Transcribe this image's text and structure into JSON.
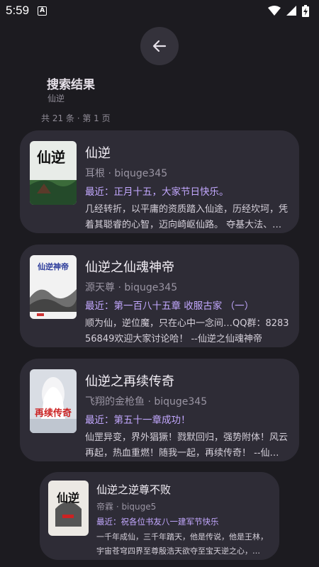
{
  "status": {
    "time": "5:59",
    "notification_letter": "A"
  },
  "header": {
    "title": "搜索结果",
    "query": "仙逆",
    "count_text": "共 21 条 · 第 1 页"
  },
  "results": [
    {
      "title": "仙逆",
      "meta": "耳根 · biquge345",
      "latest": "最近：正月十五，大家节日快乐。",
      "intro": "几经转折，以平庸的资质踏入仙途，历经坎坷，凭着其聪睿的心智，迈向崎岖仙路。 夺基大法、…",
      "cover_text": "仙逆"
    },
    {
      "title": "仙逆之仙魂神帝",
      "meta": "源天尊 · biquge345",
      "latest": "最近：第一百八十五章 收服古家 （一）",
      "intro": "顺为仙，逆位魔，只在心中一念间…QQ群：828356849欢迎大家讨论哈！ --仙逆之仙魂神帝",
      "cover_text": "仙逆神帝"
    },
    {
      "title": "仙逆之再续传奇",
      "meta": "飞翔的金枪鱼 · biquge345",
      "latest": "最近：第五十一章成功！",
      "intro": "仙罡异变，界外猖獗！戮默回归，强势附体！风云再起，热血重燃！随我一起，再续传奇！ --仙…",
      "cover_text": "再续传奇"
    },
    {
      "title": "仙逆之逆尊不败",
      "meta": "帝霖 · biquge5",
      "latest": "最近：祝各位书友八一建军节快乐",
      "intro": "一千年成仙，三千年踏天，他是传说，他是王林，宇宙苍穹四界至尊殷浩天欲夺至宝天逆之心，…",
      "cover_text": "仙逆"
    }
  ],
  "colors": {
    "background": "#1c1b20",
    "card": "#2e2c36",
    "accent": "#c3a8ff"
  },
  "icons": {
    "back": "arrow-left-icon",
    "wifi": "wifi-icon",
    "signal": "signal-icon",
    "battery": "battery-charging-icon"
  }
}
